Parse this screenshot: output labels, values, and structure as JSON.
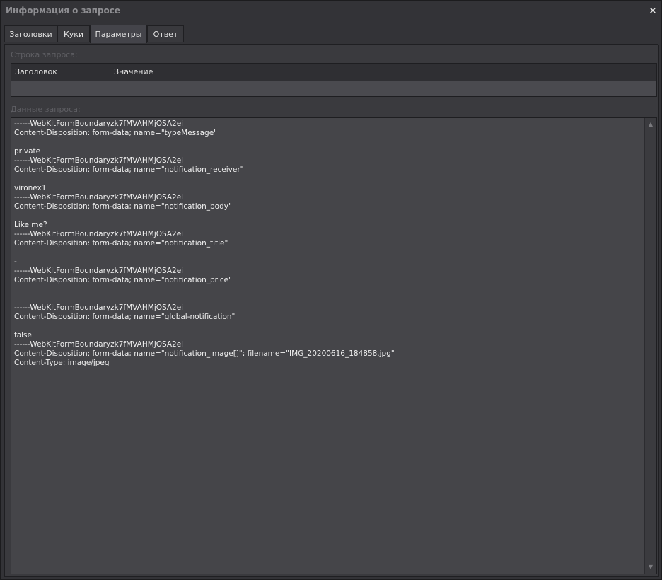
{
  "window": {
    "title": "Информация о запросе",
    "close_icon": "×"
  },
  "tabs": [
    {
      "label": "Заголовки",
      "active": false
    },
    {
      "label": "Куки",
      "active": false
    },
    {
      "label": "Параметры",
      "active": true
    },
    {
      "label": "Ответ",
      "active": false
    }
  ],
  "query_string": {
    "label": "Строка запроса:",
    "columns": [
      "Заголовок",
      "Значение"
    ],
    "rows": []
  },
  "request_data": {
    "label": "Данные запроса:",
    "text": "------WebKitFormBoundaryzk7fMVAHMjOSA2ei\nContent-Disposition: form-data; name=\"typeMessage\"\n\nprivate\n------WebKitFormBoundaryzk7fMVAHMjOSA2ei\nContent-Disposition: form-data; name=\"notification_receiver\"\n\nvironex1\n------WebKitFormBoundaryzk7fMVAHMjOSA2ei\nContent-Disposition: form-data; name=\"notification_body\"\n\nLike me?\n------WebKitFormBoundaryzk7fMVAHMjOSA2ei\nContent-Disposition: form-data; name=\"notification_title\"\n\n-\n------WebKitFormBoundaryzk7fMVAHMjOSA2ei\nContent-Disposition: form-data; name=\"notification_price\"\n\n\n------WebKitFormBoundaryzk7fMVAHMjOSA2ei\nContent-Disposition: form-data; name=\"global-notification\"\n\nfalse\n------WebKitFormBoundaryzk7fMVAHMjOSA2ei\nContent-Disposition: form-data; name=\"notification_image[]\"; filename=\"IMG_20200616_184858.jpg\"\nContent-Type: image/jpeg"
  },
  "scrollbar": {
    "up_icon": "▲",
    "down_icon": "▼"
  },
  "colors": {
    "background": "#333337",
    "panel": "#3a3a3e",
    "textarea": "#454549",
    "label_muted": "#5f5f64",
    "text": "#f0f0f0"
  }
}
